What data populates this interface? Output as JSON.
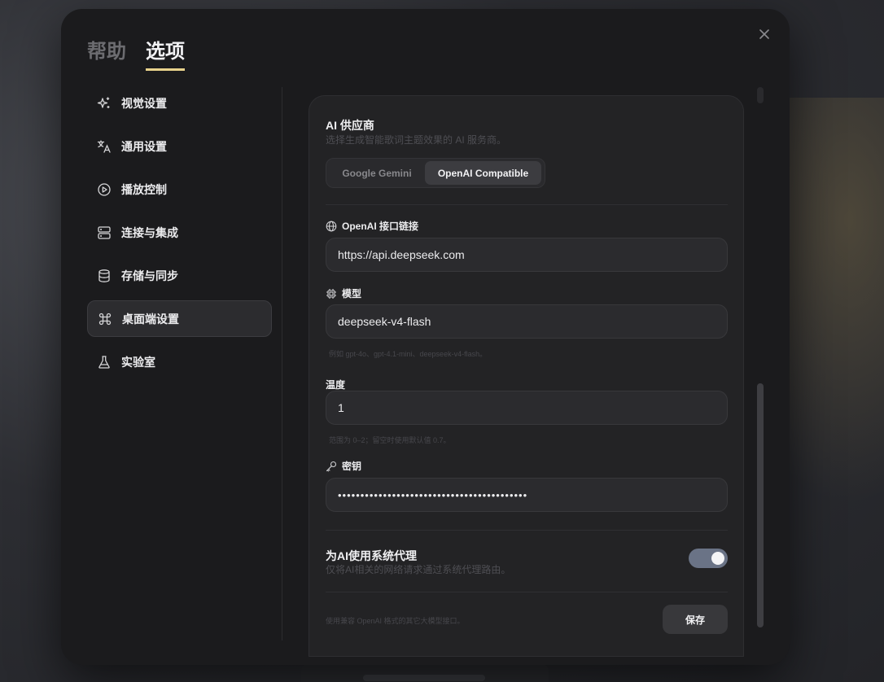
{
  "tabs": [
    {
      "label": "帮助",
      "active": false
    },
    {
      "label": "选项",
      "active": true
    }
  ],
  "sidebar": {
    "items": [
      {
        "label": "视觉设置",
        "icon": "sparkles-icon"
      },
      {
        "label": "通用设置",
        "icon": "translate-icon"
      },
      {
        "label": "播放控制",
        "icon": "play-circle-icon"
      },
      {
        "label": "连接与集成",
        "icon": "server-icon"
      },
      {
        "label": "存储与同步",
        "icon": "database-icon"
      },
      {
        "label": "桌面端设置",
        "icon": "command-icon",
        "active": true
      },
      {
        "label": "实验室",
        "icon": "flask-icon"
      }
    ]
  },
  "provider": {
    "title": "AI 供应商",
    "desc": "选择生成智能歌词主题效果的 AI 服务商。",
    "options": [
      "Google Gemini",
      "OpenAI Compatible"
    ],
    "selected": "OpenAI Compatible"
  },
  "fields": {
    "endpoint": {
      "label": "OpenAI 接口链接",
      "value": "https://api.deepseek.com"
    },
    "model": {
      "label": "模型",
      "value": "deepseek-v4-flash",
      "hint": "例如 gpt-4o、gpt-4.1-mini、deepseek-v4-flash。"
    },
    "temperature": {
      "label": "温度",
      "value": "1",
      "hint": "范围为 0–2；留空时使用默认值 0.7。"
    },
    "key": {
      "label": "密钥",
      "value": "••••••••••••••••••••••••••••••••••••••••••"
    }
  },
  "proxy": {
    "title": "为AI使用系统代理",
    "desc": "仅将AI相关的网络请求通过系统代理路由。",
    "enabled": true
  },
  "footer": {
    "note": "使用兼容 OpenAI 格式的其它大模型接口。",
    "save_label": "保存"
  },
  "colors": {
    "accent_underline": "#e8d28c",
    "toggle_on": "#6a7386"
  }
}
